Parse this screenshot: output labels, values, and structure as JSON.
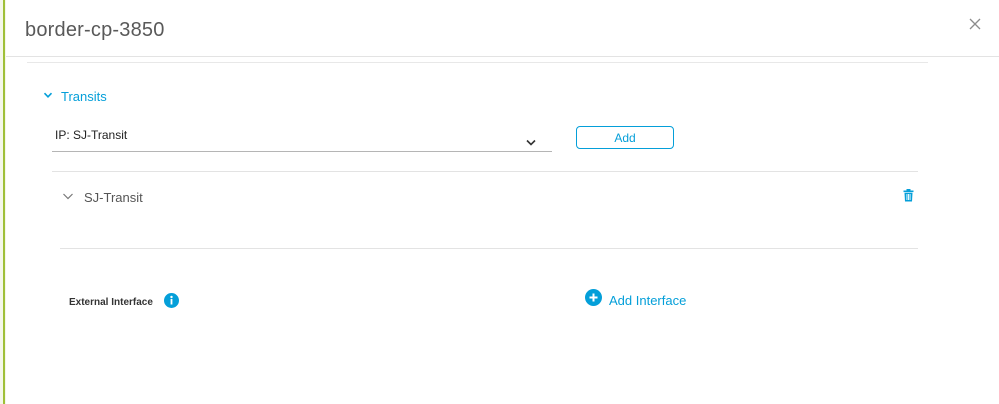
{
  "dialog": {
    "title": "border-cp-3850"
  },
  "transits": {
    "section_label": "Transits",
    "select_value": "IP: SJ-Transit",
    "add_label": "Add",
    "items": [
      {
        "name": "SJ-Transit"
      }
    ]
  },
  "external_interface": {
    "label": "External Interface",
    "add_label": "Add Interface"
  },
  "colors": {
    "accent": "#049fd9",
    "left_bar": "#9fc038"
  },
  "icons": [
    "close-icon",
    "chevron-down-icon",
    "trash-icon",
    "info-icon",
    "plus-circle-icon"
  ]
}
